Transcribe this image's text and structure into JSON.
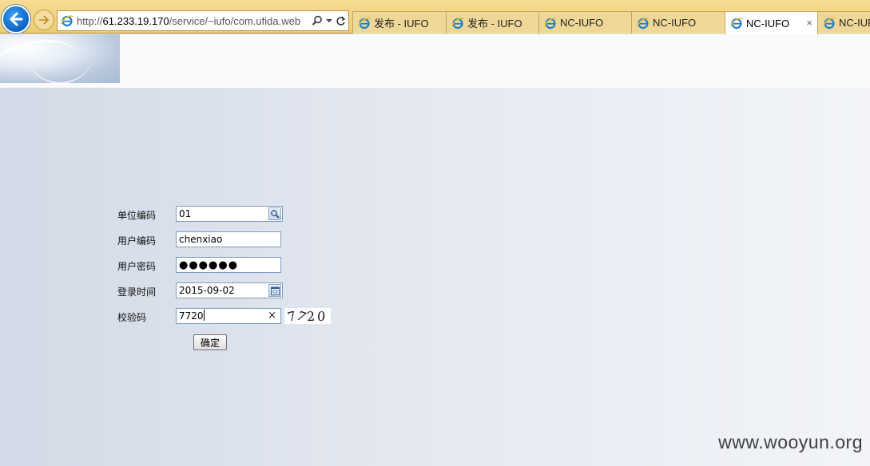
{
  "browser": {
    "url_prefix": "http://",
    "url_host": "61.233.19.170",
    "url_path": "/service/~iufo/com.ufida.web",
    "tabs": [
      {
        "label": "发布 - IUFO",
        "active": false
      },
      {
        "label": "发布 - IUFO",
        "active": false
      },
      {
        "label": "NC-IUFO",
        "active": false
      },
      {
        "label": "NC-IUFO",
        "active": false
      },
      {
        "label": "NC-IUFO",
        "active": true
      },
      {
        "label": "NC-IUFO",
        "active": false
      }
    ],
    "close_glyph": "×"
  },
  "form": {
    "unit_code": {
      "label": "单位编码",
      "value": "01"
    },
    "user_code": {
      "label": "用户编码",
      "value": "chenxiao"
    },
    "password": {
      "label": "用户密码",
      "value": "●●●●●●"
    },
    "login_date": {
      "label": "登录时间",
      "value": "2015-09-02"
    },
    "verify_code": {
      "label": "校验码",
      "value": "7720",
      "clear_glyph": "×"
    },
    "captcha_chars": [
      "7",
      "7",
      "2",
      "0"
    ],
    "submit_label": "确定"
  },
  "watermark": "www.wooyun.org",
  "colors": {
    "chrome": "#eecd72",
    "field_border": "#7f9db9",
    "ie_blue": "#1a7fd1"
  }
}
